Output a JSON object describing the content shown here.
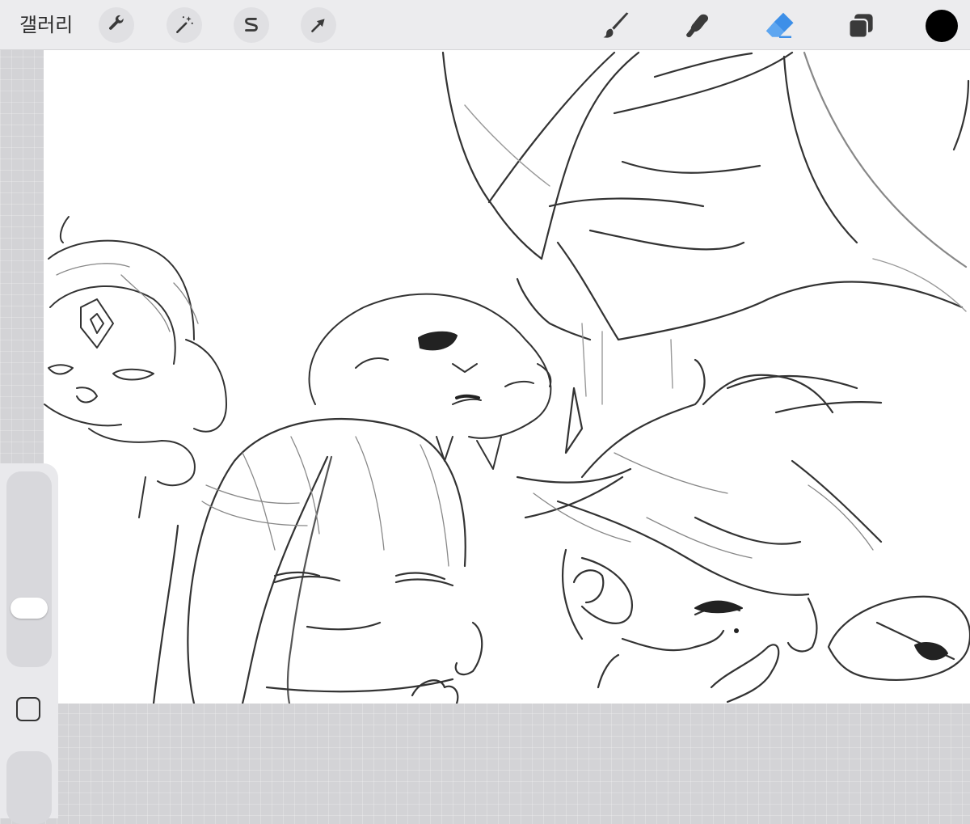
{
  "toolbar": {
    "gallery_label": "갤러리",
    "left_tools": [
      {
        "name": "wrench-icon",
        "action": "actions"
      },
      {
        "name": "magic-wand-icon",
        "action": "adjustments"
      },
      {
        "name": "selection-s-icon",
        "action": "selection"
      },
      {
        "name": "arrow-cursor-icon",
        "action": "transform"
      }
    ],
    "right_tools": [
      {
        "name": "brush-icon",
        "action": "paint"
      },
      {
        "name": "smudge-icon",
        "action": "smudge"
      },
      {
        "name": "eraser-icon",
        "action": "erase",
        "active": true
      },
      {
        "name": "layers-icon",
        "action": "layers"
      }
    ],
    "active_color": "#000000",
    "accent": "#3d8fe8"
  },
  "sidebar": {
    "brush_size_slider": "brush-size",
    "opacity_slider": "opacity",
    "modify_button": "color-picker"
  },
  "canvas": {
    "content": "sketch-artwork"
  }
}
